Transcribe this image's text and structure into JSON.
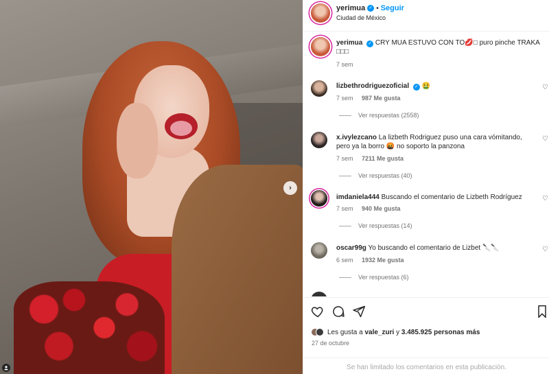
{
  "post": {
    "username": "yerimua",
    "follow_label": "Seguir",
    "location": "Ciudad de México"
  },
  "caption": {
    "username": "yerimua",
    "text": "CRY MUA ESTUVO CON TO💋□ puro pinche TRAKA □□□",
    "time": "7 sem"
  },
  "comments": [
    {
      "username": "lizbethrodriguezoficial",
      "verified": true,
      "text": "🤮",
      "time": "7 sem",
      "likes": "987 Me gusta",
      "reply": "",
      "replies": "Ver respuestas (2558)"
    },
    {
      "username": "x.ivylezcano",
      "verified": false,
      "text": "La lizbeth Rodriguez puso una cara vómitando, pero ya la borro 🤬 no soporto la panzona",
      "time": "7 sem",
      "likes": "7211 Me gusta",
      "reply": "",
      "replies": "Ver respuestas (40)"
    },
    {
      "username": "imdaniela444",
      "verified": false,
      "text": "Buscando el comentario de Lizbeth Rodríguez",
      "time": "7 sem",
      "likes": "940 Me gusta",
      "reply": "",
      "replies": "Ver respuestas (14)"
    },
    {
      "username": "oscar99g",
      "verified": false,
      "text": "Yo buscando el comentario de Lizbet 🔪🔪",
      "time": "6 sem",
      "likes": "1932 Me gusta",
      "reply": "",
      "replies": "Ver respuestas (6)"
    }
  ],
  "likes": {
    "prefix": "Les gusta a ",
    "user": "vale_zuri",
    "middle": " y ",
    "count": "3.485.925 personas más"
  },
  "date": "27 de octubre",
  "limited_notice": "Se han limitado los comentarios en esta publicación.",
  "icons": {
    "next": "chevron-right-icon",
    "verified": "verified-badge-icon",
    "like": "heart-icon",
    "comment": "comment-icon",
    "share": "share-icon",
    "save": "bookmark-icon",
    "user_tag": "user-tag-icon"
  },
  "colors": {
    "link": "#0095f6",
    "muted": "#737373",
    "text": "#262626"
  }
}
